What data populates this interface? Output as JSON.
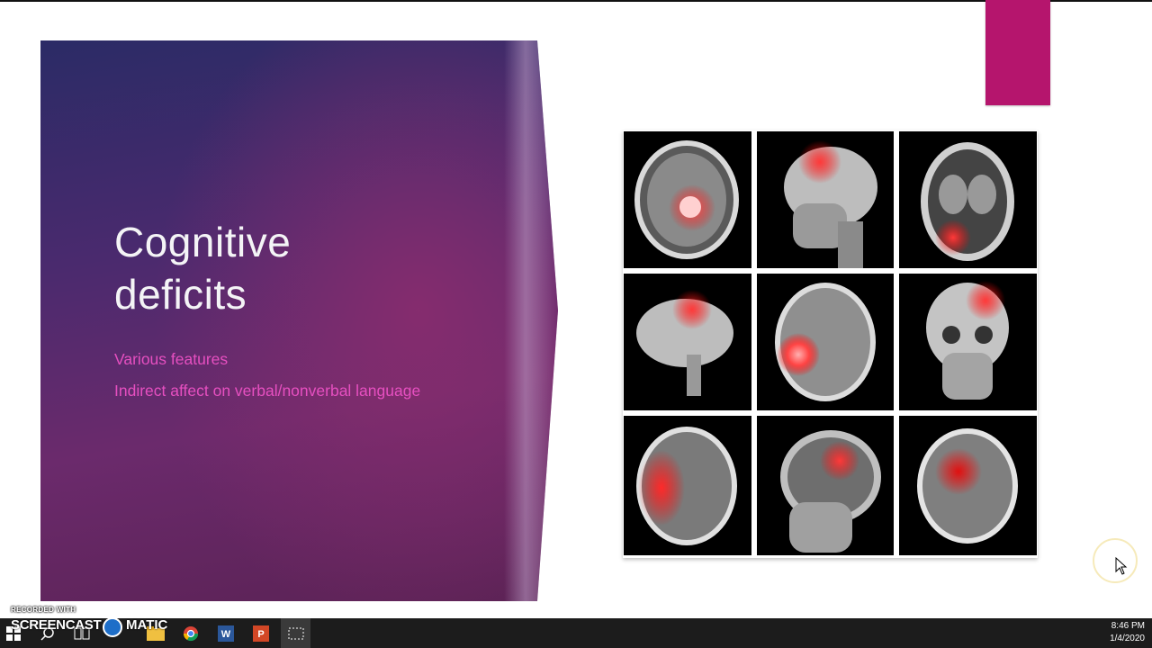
{
  "slide": {
    "title_line1": "Cognitive",
    "title_line2": "deficits",
    "bullets": [
      "Various features",
      "Indirect affect on verbal/nonverbal language"
    ],
    "accent_color": "#b5156d",
    "panel_colors": [
      "#2b2b66",
      "#6b2a6c"
    ],
    "bullet_color": "#e64fc0"
  },
  "image": {
    "description_icon": "brain-scan-grid",
    "cells": [
      "ct-axial-hemorrhage",
      "xray-skull-lateral",
      "ct-axial-cerebellum",
      "mri-sagittal-brain",
      "mri-axial-tumor",
      "xray-skull-frontal",
      "ct-axial-large-hemorrhage",
      "mri-sagittal-head",
      "ct-axial-bleed"
    ]
  },
  "watermark": {
    "small": "RECORDED WITH",
    "big_left": "SCREENCAST",
    "big_right": "MATIC"
  },
  "taskbar": {
    "icons": [
      "windows-start-icon",
      "search-icon",
      "task-view-icon",
      "file-explorer-icon",
      "chrome-icon",
      "word-icon",
      "powerpoint-icon",
      "snipping-tool-icon"
    ],
    "time": "8:46 PM",
    "date": "1/4/2020"
  }
}
